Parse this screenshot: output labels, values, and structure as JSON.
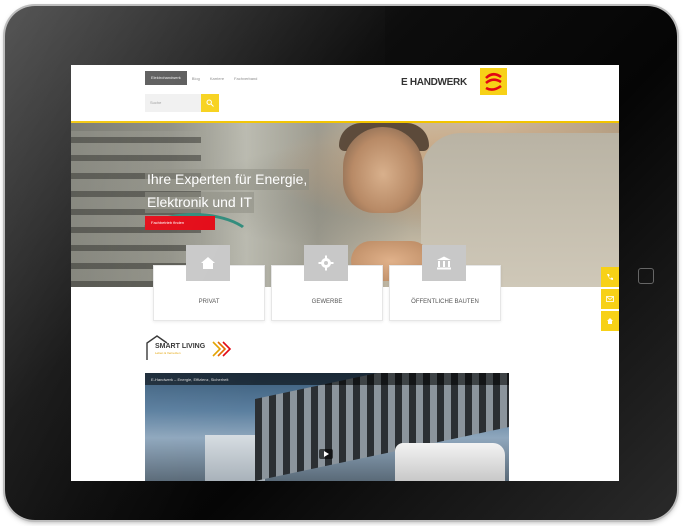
{
  "header": {
    "nav": [
      "Elektrohandwerk",
      "Blog",
      "Karriere",
      "Fachverband"
    ],
    "search_placeholder": "Suche",
    "logo_text": "E HANDWERK"
  },
  "hero": {
    "tagline_line1": "Ihre Experten für Energie,",
    "tagline_line2": "Elektronik und IT",
    "cta_label": "Fachbetrieb finden"
  },
  "categories": [
    {
      "label": "PRIVAT",
      "icon": "house-icon"
    },
    {
      "label": "GEWERBE",
      "icon": "gear-icon"
    },
    {
      "label": "ÖFFENTLICHE BAUTEN",
      "icon": "building-icon"
    }
  ],
  "smart_living": {
    "title": "SMART LIVING",
    "subtitle": "Leben & Vernetzen"
  },
  "video": {
    "title": "E-Handwerk – Energie, Effizienz, Sicherheit"
  },
  "colors": {
    "accent_yellow": "#f7d117",
    "cta_red": "#e30613"
  },
  "side_tabs": [
    "phone-icon",
    "mail-icon",
    "home-icon"
  ]
}
